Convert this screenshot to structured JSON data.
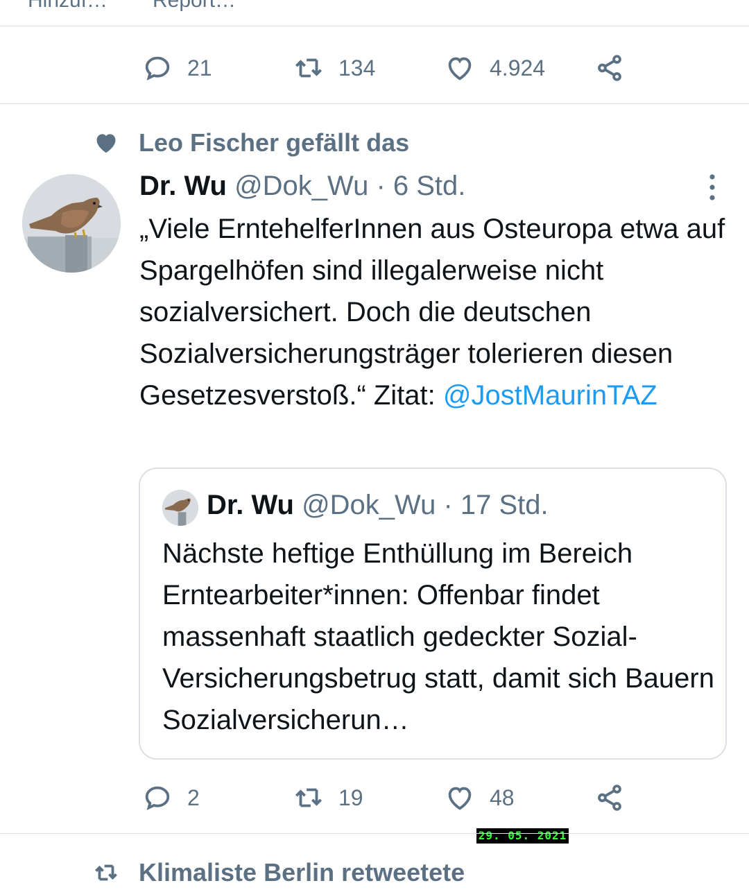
{
  "top_stub": {
    "left_label": "Hinzuf…",
    "right_label": "Report…"
  },
  "tweet1_actions": {
    "replies": "21",
    "retweets": "134",
    "likes": "4.924"
  },
  "tweet2": {
    "social_context": "Leo Fischer gefällt das",
    "author_name": "Dr. Wu",
    "author_handle_time": "@Dok_Wu · 6 Std.",
    "text": "„Viele ErntehelferInnen aus Osteuropa etwa auf Spargelhöfen sind illegalerweise nicht sozialversichert. Doch die deutschen Sozialversicherungsträger tolerieren diesen Gesetzesverstoß.“ Zitat: ",
    "mention": "@JostMaurinTAZ",
    "quote": {
      "author_name": "Dr. Wu",
      "author_handle_time": "@Dok_Wu · 17 Std.",
      "text": "Nächste heftige Enthüllung im Bereich Erntearbeiter*innen: Offenbar findet massenhaft staatlich gedeckter Sozial-Versicherungsbetrug statt, damit sich Bauern Sozialversicherun…"
    },
    "actions": {
      "replies": "2",
      "retweets": "19",
      "likes": "48"
    }
  },
  "date_stamp": "29. 05. 2021",
  "tweet3": {
    "social_context": "Klimaliste Berlin retweetete"
  },
  "colors": {
    "text": "#0f1419",
    "secondary": "#5b7083",
    "link": "#1d9bf0",
    "divider": "#dcdfe3",
    "stamp": "#39ff3a"
  },
  "icons": [
    "reply-icon",
    "retweet-icon",
    "like-icon",
    "share-icon",
    "heart-filled-icon",
    "more-options-icon"
  ]
}
